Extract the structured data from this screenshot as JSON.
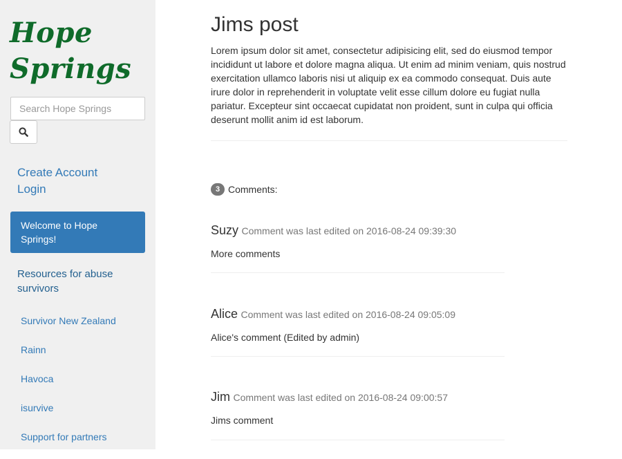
{
  "sidebar": {
    "logo_line1": "Hope",
    "logo_line2": "Springs",
    "search": {
      "placeholder": "Search Hope Springs",
      "value": "",
      "button_icon": "search-icon"
    },
    "account_links": [
      "Create Account",
      "Login"
    ],
    "welcome_text": "Welcome to Hope Springs!",
    "resources_heading": "Resources for abuse survivors",
    "resources": [
      "Survivor New Zealand",
      "Rainn",
      "Havoca",
      "isurvive",
      "Support for partners"
    ]
  },
  "post": {
    "title": "Jims post",
    "body": "Lorem ipsum dolor sit amet, consectetur adipisicing elit, sed do eiusmod tempor incididunt ut labore et dolore magna aliqua. Ut enim ad minim veniam, quis nostrud exercitation ullamco laboris nisi ut aliquip ex ea commodo consequat. Duis aute irure dolor in reprehenderit in voluptate velit esse cillum dolore eu fugiat nulla pariatur. Excepteur sint occaecat cupidatat non proident, sunt in culpa qui officia deserunt mollit anim id est laborum."
  },
  "comments": {
    "count": "3",
    "label": "Comments:",
    "items": [
      {
        "author": "Suzy",
        "meta": "Comment was last edited on 2016-08-24 09:39:30",
        "text": "More comments"
      },
      {
        "author": "Alice",
        "meta": "Comment was last edited on 2016-08-24 09:05:09",
        "text": "Alice's comment (Edited by admin)"
      },
      {
        "author": "Jim",
        "meta": "Comment was last edited on 2016-08-24 09:00:57",
        "text": "Jims comment"
      }
    ]
  },
  "colors": {
    "logo": "#0f6b2a",
    "link": "#337ab7",
    "welcome_bg": "#337ab7",
    "sidebar_bg": "#f0f0f0",
    "badge_bg": "#777777"
  }
}
